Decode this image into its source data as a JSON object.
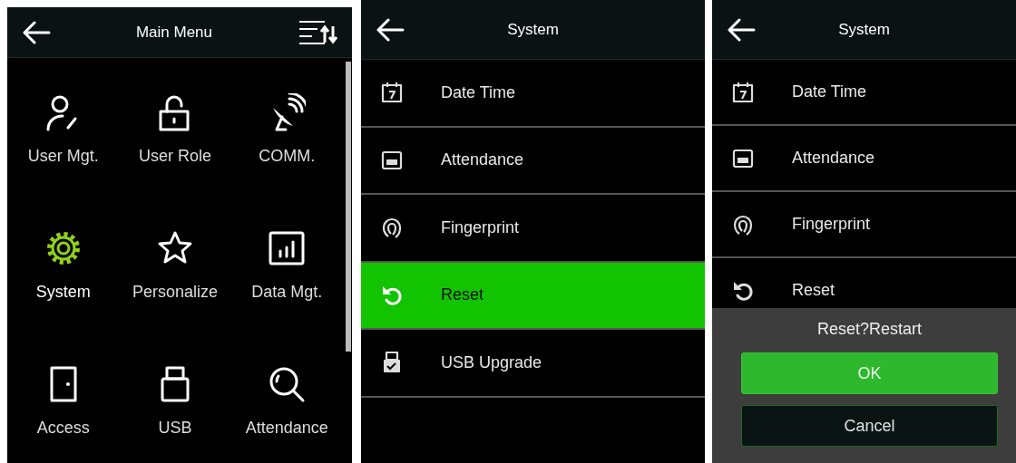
{
  "main_menu": {
    "title": "Main Menu",
    "items": [
      {
        "label": "User Mgt.",
        "selected": false
      },
      {
        "label": "User Role",
        "selected": false
      },
      {
        "label": "COMM.",
        "selected": false
      },
      {
        "label": "System",
        "selected": true
      },
      {
        "label": "Personalize",
        "selected": false
      },
      {
        "label": "Data Mgt.",
        "selected": false
      },
      {
        "label": "Access",
        "selected": false
      },
      {
        "label": "USB",
        "selected": false
      },
      {
        "label": "Attendance",
        "selected": false
      }
    ]
  },
  "system": {
    "title": "System",
    "items": [
      {
        "label": "Date Time",
        "selected": false
      },
      {
        "label": "Attendance",
        "selected": false
      },
      {
        "label": "Fingerprint",
        "selected": false
      },
      {
        "label": "Reset",
        "selected": true
      },
      {
        "label": "USB Upgrade",
        "selected": false
      }
    ]
  },
  "system_dialog": {
    "title": "System",
    "items": [
      {
        "label": "Date Time",
        "selected": false
      },
      {
        "label": "Attendance",
        "selected": false
      },
      {
        "label": "Fingerprint",
        "selected": false
      },
      {
        "label": "Reset",
        "selected": false
      }
    ],
    "dialog": {
      "message": "Reset?Restart",
      "buttons": [
        {
          "label": "OK",
          "kind": "primary"
        },
        {
          "label": "Cancel",
          "kind": "secondary"
        }
      ]
    }
  }
}
